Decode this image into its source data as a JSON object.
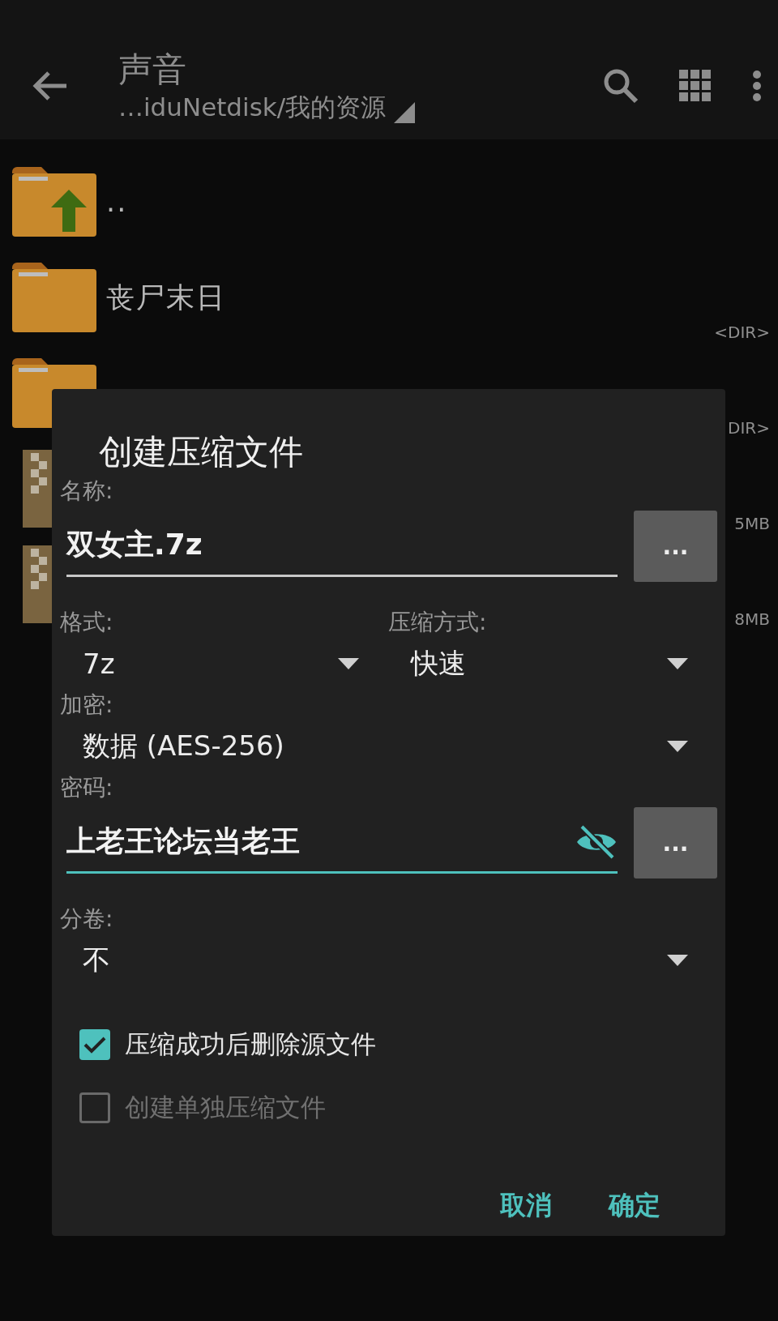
{
  "app_bar": {
    "title": "声音",
    "path": "…iduNetdisk/我的资源"
  },
  "files": [
    {
      "kind": "parent",
      "name": ".."
    },
    {
      "kind": "folder",
      "name": "丧尸末日",
      "size": "<DIR>"
    },
    {
      "kind": "folder",
      "size": "DIR>"
    },
    {
      "kind": "archive",
      "size": "5MB"
    },
    {
      "kind": "archive",
      "size": "8MB"
    }
  ],
  "dialog": {
    "title": "创建压缩文件",
    "name": {
      "label": "名称:",
      "value": "双女主.7z",
      "focused": false,
      "browse": "..."
    },
    "format": {
      "label": "格式:",
      "value": "7z"
    },
    "method": {
      "label": "压缩方式:",
      "value": "快速"
    },
    "encryption": {
      "label": "加密:",
      "value": "数据 (AES-256)"
    },
    "password": {
      "label": "密码:",
      "value": "上老王论坛当老王",
      "focused": true,
      "browse": "..."
    },
    "split": {
      "label": "分卷:",
      "value": "不"
    },
    "checkboxes": [
      {
        "label": "压缩成功后删除源文件",
        "checked": true,
        "disabled": false
      },
      {
        "label": "创建单独压缩文件",
        "checked": false,
        "disabled": true
      }
    ],
    "buttons": [
      "取消",
      "确定"
    ]
  }
}
